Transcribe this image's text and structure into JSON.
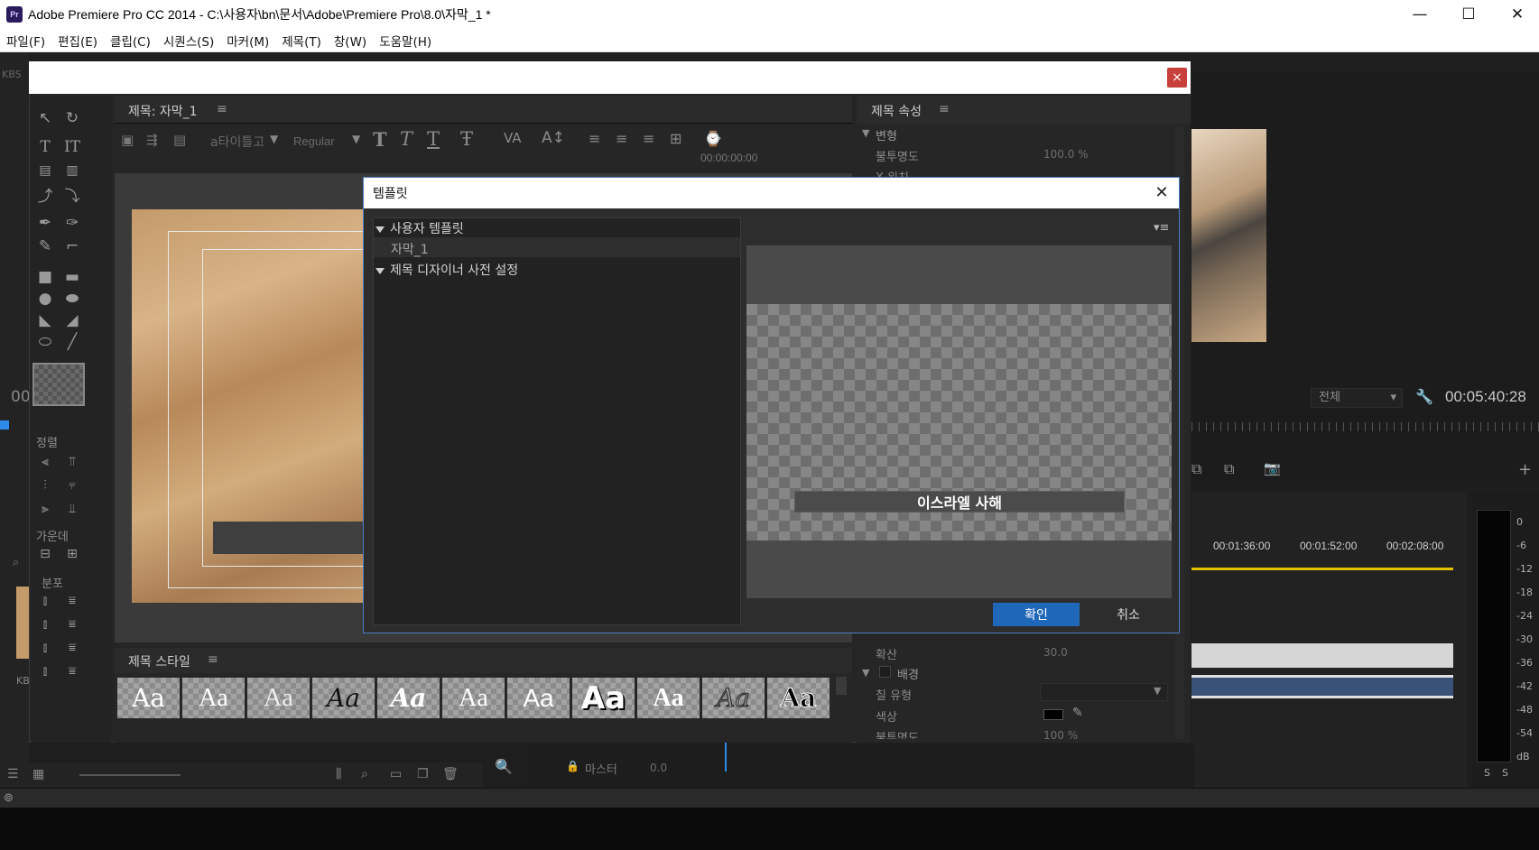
{
  "window": {
    "title": "Adobe Premiere Pro CC 2014 - C:\\사용자\\bn\\문서\\Adobe\\Premiere Pro\\8.0\\자막_1 *",
    "app_icon": "Pr",
    "minimize": "—",
    "maximize": "☐",
    "close": "✕"
  },
  "menu": [
    "파일(F)",
    "편집(E)",
    "클립(C)",
    "시퀀스(S)",
    "마커(M)",
    "제목(T)",
    "창(W)",
    "도움말(H)"
  ],
  "left_peek": {
    "kbs1": "KBS",
    "kbs2": "KB",
    "timecode": "00"
  },
  "designer": {
    "close": "×",
    "canvas_tab": "제목: 자막_1",
    "font_family": "a타이틀고",
    "font_style": "Regular",
    "timecode": "00:00:00:00",
    "styles_tab": "제목 스타일",
    "style_sample": "Aa",
    "props_tab": "제목 속성",
    "props": {
      "transform": "변형",
      "opacity_label": "불투명도",
      "opacity_value": "100.0 %",
      "x_label": "X 위치",
      "spread_label": "확산",
      "spread_value": "30.0",
      "background": "배경",
      "fill_type": "칠 유형",
      "color": "색상",
      "opacity2_label": "불투명도",
      "opacity2_value": "100 %"
    },
    "side_labels": {
      "align": "정렬",
      "center": "가운데",
      "distribute": "분포"
    }
  },
  "template_dialog": {
    "title": "템플릿",
    "close": "✕",
    "tree": [
      {
        "label": "사용자 템플릿",
        "expanded": true
      },
      {
        "label": "자막_1",
        "child": true,
        "selected": true
      },
      {
        "label": "제목 디자이너 사전 설정",
        "expanded": true
      }
    ],
    "menu_icon": "▾≡",
    "preview_text": "이스라엘 사해",
    "ok": "확인",
    "cancel": "취소"
  },
  "program_monitor": {
    "zoom": "전체",
    "timecode": "00:05:40:28"
  },
  "timeline": {
    "times": [
      "00:01:36:00",
      "00:01:52:00",
      "00:02:08:00"
    ],
    "master": "마스터",
    "master_value": "0.0"
  },
  "meter": {
    "ticks": [
      "0",
      "-6",
      "-12",
      "-18",
      "-24",
      "-30",
      "-36",
      "-42",
      "-48",
      "-54",
      "dB"
    ],
    "solo": [
      "S",
      "S"
    ]
  }
}
